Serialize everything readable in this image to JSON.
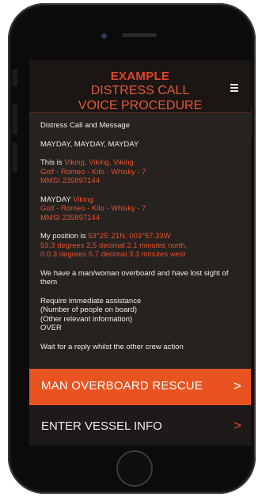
{
  "header": {
    "title": "EXAMPLE",
    "subtitle_line1": "DISTRESS CALL",
    "subtitle_line2": "VOICE PROCEDURE",
    "menu_icon": "hamburger-menu-icon"
  },
  "content": {
    "heading": "Distress Call and Message",
    "mayday": "MAYDAY, MAYDAY, MAYDAY",
    "this_is_prefix": "This is",
    "this_is_vessel": "Viking, Viking, Viking",
    "phonetic_1": "Golf - Romeo - Kilo - Whisky - 7",
    "mmsi_1": "MMSI 235897144",
    "mayday_prefix": "MAYDAY",
    "mayday_vessel": "Viking",
    "phonetic_2": "Golf - Romeo - Kilo - Whisky - 7",
    "mmsi_2": "MMSI 235897144",
    "position_prefix": "My position is",
    "position_coords": "53°25'.21N, 003°57.33W",
    "position_line2": "53.3 degrees 2.5 decimal 2.1 minutes north,",
    "position_line3": "0.0.3 degrees 5.7 decimal 3.3 minutes west",
    "situation": "We have a man/woman overboard and have lost sight of them",
    "assist_1": "Require immediate assistance",
    "assist_2": "(Number of people on board)",
    "assist_3": "(Other relevant information)",
    "assist_4": "OVER",
    "wait": "Wait for a reply whilst the other crew action"
  },
  "buttons": {
    "rescue_label": "MAN OVERBOARD RESCUE",
    "vessel_label": "ENTER VESSEL INFO",
    "chevron": ">"
  },
  "colors": {
    "accent": "#e8531f",
    "highlight_text": "#e0532f",
    "background": "#262220"
  }
}
